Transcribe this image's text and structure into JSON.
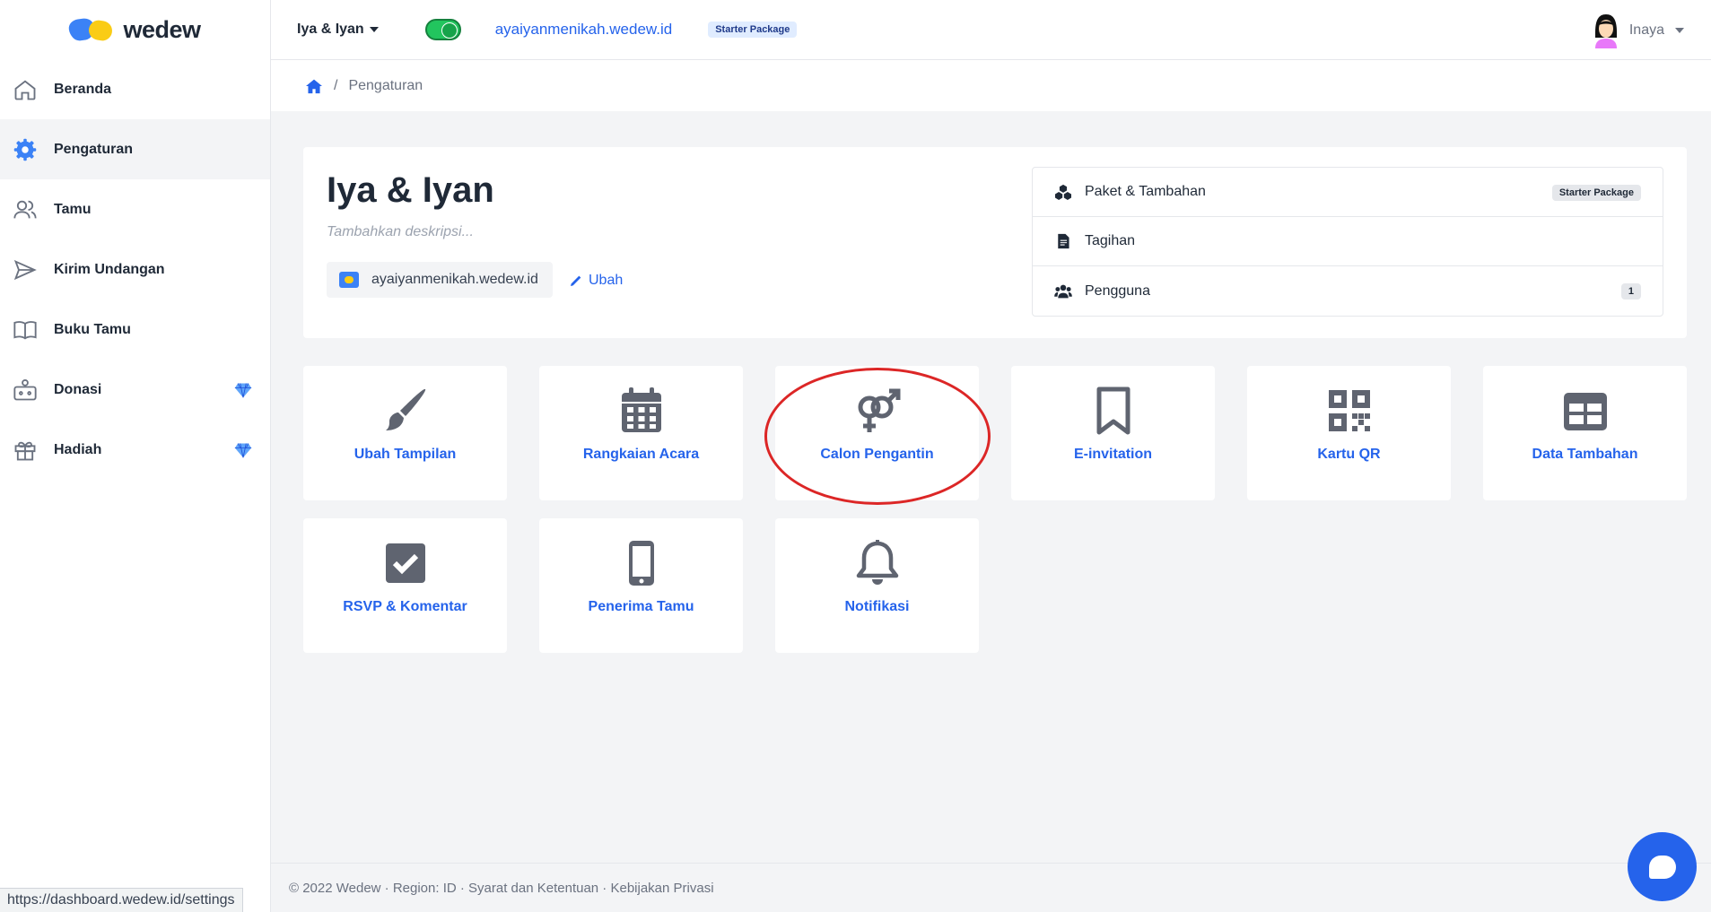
{
  "app": {
    "logo_text": "wedew"
  },
  "sidebar": {
    "items": [
      {
        "label": "Beranda",
        "icon": "home-icon"
      },
      {
        "label": "Pengaturan",
        "icon": "gear-icon",
        "active": true
      },
      {
        "label": "Tamu",
        "icon": "users-icon"
      },
      {
        "label": "Kirim Undangan",
        "icon": "send-icon"
      },
      {
        "label": "Buku Tamu",
        "icon": "book-icon"
      },
      {
        "label": "Donasi",
        "icon": "donation-icon",
        "premium": true
      },
      {
        "label": "Hadiah",
        "icon": "gift-icon",
        "premium": true
      }
    ]
  },
  "topbar": {
    "project": "Iya & Iyan",
    "url": "ayaiyanmenikah.wedew.id",
    "package_badge": "Starter Package",
    "user_name": "Inaya"
  },
  "breadcrumb": {
    "current": "Pengaturan"
  },
  "main": {
    "title": "Iya & Iyan",
    "description_placeholder": "Tambahkan deskripsi...",
    "url": "ayaiyanmenikah.wedew.id",
    "edit_label": "Ubah"
  },
  "side_list": [
    {
      "label": "Paket & Tambahan",
      "icon": "cubes-icon",
      "badge": "Starter Package"
    },
    {
      "label": "Tagihan",
      "icon": "invoice-icon"
    },
    {
      "label": "Pengguna",
      "icon": "users-gear-icon",
      "badge": "1"
    }
  ],
  "tiles": [
    {
      "label": "Ubah Tampilan",
      "icon": "paintbrush-icon"
    },
    {
      "label": "Rangkaian Acara",
      "icon": "calendar-icon"
    },
    {
      "label": "Calon Pengantin",
      "icon": "venus-mars-icon"
    },
    {
      "label": "E-invitation",
      "icon": "bookmark-icon"
    },
    {
      "label": "Kartu QR",
      "icon": "qrcode-icon"
    },
    {
      "label": "Data Tambahan",
      "icon": "table-icon"
    },
    {
      "label": "RSVP & Komentar",
      "icon": "check-square-icon"
    },
    {
      "label": "Penerima Tamu",
      "icon": "mobile-icon"
    },
    {
      "label": "Notifikasi",
      "icon": "bell-icon"
    }
  ],
  "footer": {
    "text": "© 2022 Wedew · Region: ID · Syarat dan Ketentuan · Kebijakan Privasi"
  },
  "statusbar": {
    "url": "https://dashboard.wedew.id/settings"
  },
  "colors": {
    "accent": "#2563eb",
    "highlight": "#dc2626",
    "toggle": "#22c55e"
  }
}
